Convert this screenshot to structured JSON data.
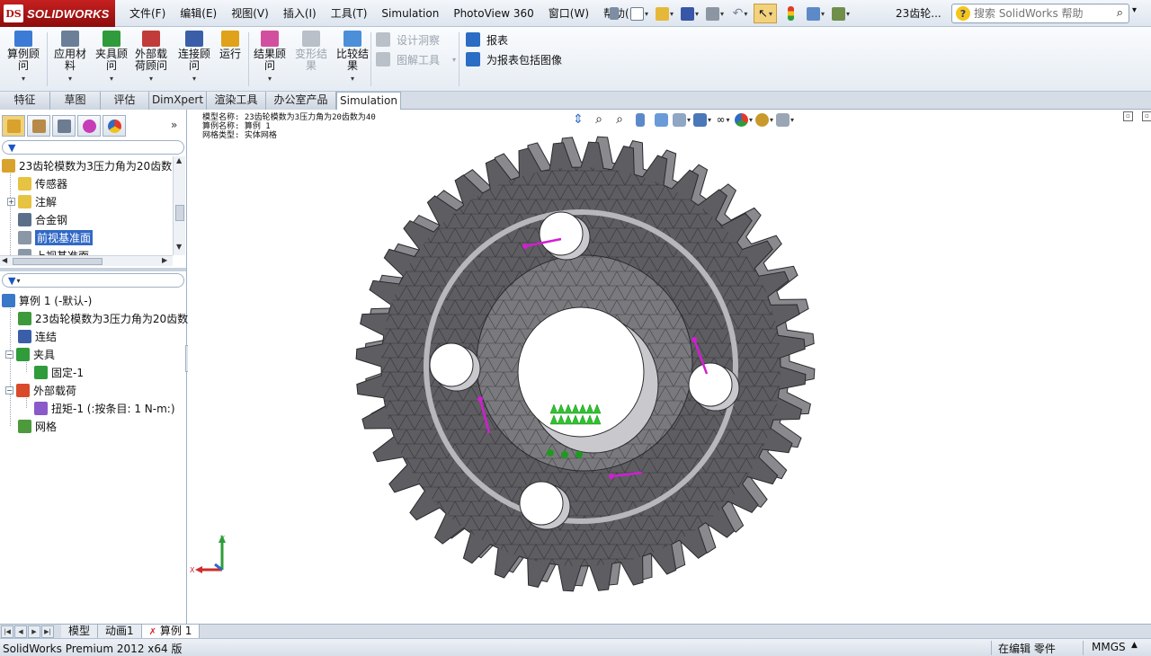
{
  "app": {
    "logo_ds": "DS",
    "logo_brand": "SOLIDWORKS",
    "document_title": "23齿轮...",
    "help_icon_text": "?"
  },
  "menu": [
    "文件(F)",
    "编辑(E)",
    "视图(V)",
    "插入(I)",
    "工具(T)",
    "Simulation",
    "PhotoView 360",
    "窗口(W)",
    "帮助(H)"
  ],
  "search": {
    "placeholder": "搜索 SolidWorks 帮助"
  },
  "ribbon": {
    "buttons": [
      {
        "label": "算例顾\n问",
        "icon": "study-advisor-icon",
        "color": "#3b7bd6",
        "disabled": false
      },
      {
        "label": "应用材\n料",
        "icon": "apply-material-icon",
        "color": "#6b7f99",
        "disabled": false
      },
      {
        "label": "夹具顾\n问",
        "icon": "fixtures-advisor-icon",
        "color": "#2f9b3a",
        "disabled": false
      },
      {
        "label": "外部载\n荷顾问",
        "icon": "external-loads-advisor-icon",
        "color": "#c23b3b",
        "disabled": false
      },
      {
        "label": "连接顾\n问",
        "icon": "connections-advisor-icon",
        "color": "#3a5fa8",
        "disabled": false
      },
      {
        "label": "运行",
        "icon": "run-icon",
        "color": "#e0a21a",
        "disabled": false
      },
      {
        "label": "结果顾\n问",
        "icon": "results-advisor-icon",
        "color": "#d24fa0",
        "disabled": false
      },
      {
        "label": "变形结\n果",
        "icon": "deformed-result-icon",
        "color": "#b9c0c8",
        "disabled": true
      },
      {
        "label": "比较结\n果",
        "icon": "compare-results-icon",
        "color": "#4a8fd8",
        "disabled": false
      }
    ],
    "small": [
      {
        "label": "设计洞察",
        "icon": "design-insight-icon",
        "color": "#b9c0c8",
        "disabled": true
      },
      {
        "label": "图解工具",
        "icon": "plot-tools-icon",
        "color": "#b9c0c8",
        "disabled": true
      },
      {
        "label": "报表",
        "icon": "report-icon",
        "color": "#2b6cc4",
        "disabled": false
      },
      {
        "label": "为报表包括图像",
        "icon": "include-image-icon",
        "color": "#2b6cc4",
        "disabled": false
      }
    ]
  },
  "tabs": [
    "特征",
    "草图",
    "评估",
    "DimXpert",
    "渲染工具",
    "办公室产品",
    "Simulation"
  ],
  "feature_tree": [
    {
      "label": "23齿轮模数为3压力角为20齿数",
      "icon": "part-icon",
      "color": "#d8a22c"
    },
    {
      "label": "传感器",
      "icon": "sensors-icon",
      "color": "#e6c341"
    },
    {
      "label": "注解",
      "icon": "annotations-icon",
      "color": "#e6c341"
    },
    {
      "label": "合金钢",
      "icon": "material-icon",
      "color": "#5b6f8a"
    },
    {
      "label": "前视基准面",
      "icon": "plane-icon",
      "color": "#8a97a6",
      "selected": true
    },
    {
      "label": "上视基准面",
      "icon": "plane-icon",
      "color": "#8a97a6"
    }
  ],
  "sim_tree": [
    {
      "label": "算例 1 (-默认-)",
      "icon": "study-icon",
      "color": "#3a78c8"
    },
    {
      "label": "23齿轮模数为3压力角为20齿数",
      "icon": "solid-body-icon",
      "color": "#3c9a3c"
    },
    {
      "label": "连结",
      "icon": "connections-icon",
      "color": "#3a5fa8"
    },
    {
      "label": "夹具",
      "icon": "fixtures-icon",
      "color": "#2f9b3a"
    },
    {
      "label": "固定-1",
      "icon": "fixed-geometry-icon",
      "color": "#2f9b3a"
    },
    {
      "label": "外部载荷",
      "icon": "external-loads-icon",
      "color": "#d84a2a"
    },
    {
      "label": "扭矩-1 (:按条目: 1 N-m:)",
      "icon": "torque-icon",
      "color": "#8a5ac8"
    },
    {
      "label": "网格",
      "icon": "mesh-icon",
      "color": "#4c9a3c"
    }
  ],
  "model_info": [
    "模型名称: 23齿轮模数为3压力角为20齿数为40",
    "算例名称: 算例 1",
    "网格类型: 实体网格"
  ],
  "triad": {
    "x": "X",
    "y": "Y"
  },
  "bottom_tabs": [
    "模型",
    "动画1",
    "算例 1"
  ],
  "status": {
    "left": "SolidWorks Premium 2012 x64 版",
    "mode": "在编辑 零件",
    "units": "MMGS"
  },
  "gear": {
    "teeth": 40,
    "body_color": "#5e5e62",
    "mesh_color": "#2a2a2e",
    "fixture_color": "#2ec42e",
    "torque_color": "#d21ed2"
  }
}
